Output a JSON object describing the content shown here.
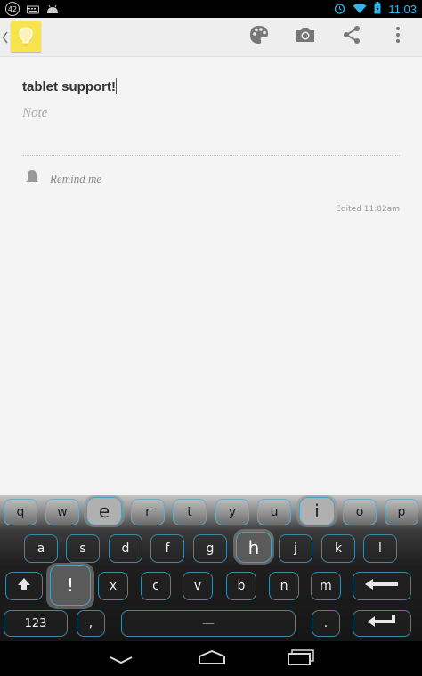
{
  "status_bar": {
    "notification_badge": "42",
    "time": "11:03"
  },
  "action_bar": {
    "icons": [
      "chevron-left-icon",
      "lightbulb-icon",
      "palette-icon",
      "camera-icon",
      "share-icon",
      "overflow-menu-icon"
    ]
  },
  "note": {
    "title": "tablet support!",
    "body_placeholder": "Note",
    "remind_label": "Remind me",
    "edited": "Edited 11:02am"
  },
  "keyboard": {
    "row1": [
      "q",
      "w",
      "e",
      "r",
      "t",
      "y",
      "u",
      "i",
      "o",
      "p"
    ],
    "row2": [
      "a",
      "s",
      "d",
      "f",
      "g",
      "h",
      "j",
      "k",
      "l"
    ],
    "row3": [
      "!",
      "x",
      "c",
      "v",
      "b",
      "n",
      "m"
    ],
    "row4": {
      "numbers": "123",
      "comma": ",",
      "space": "—",
      "period": "."
    }
  },
  "colors": {
    "accent": "#33b5e5",
    "key_border": "#3f88a4",
    "note_bg": "#f4f4f4",
    "app_icon": "#f7e34b"
  }
}
